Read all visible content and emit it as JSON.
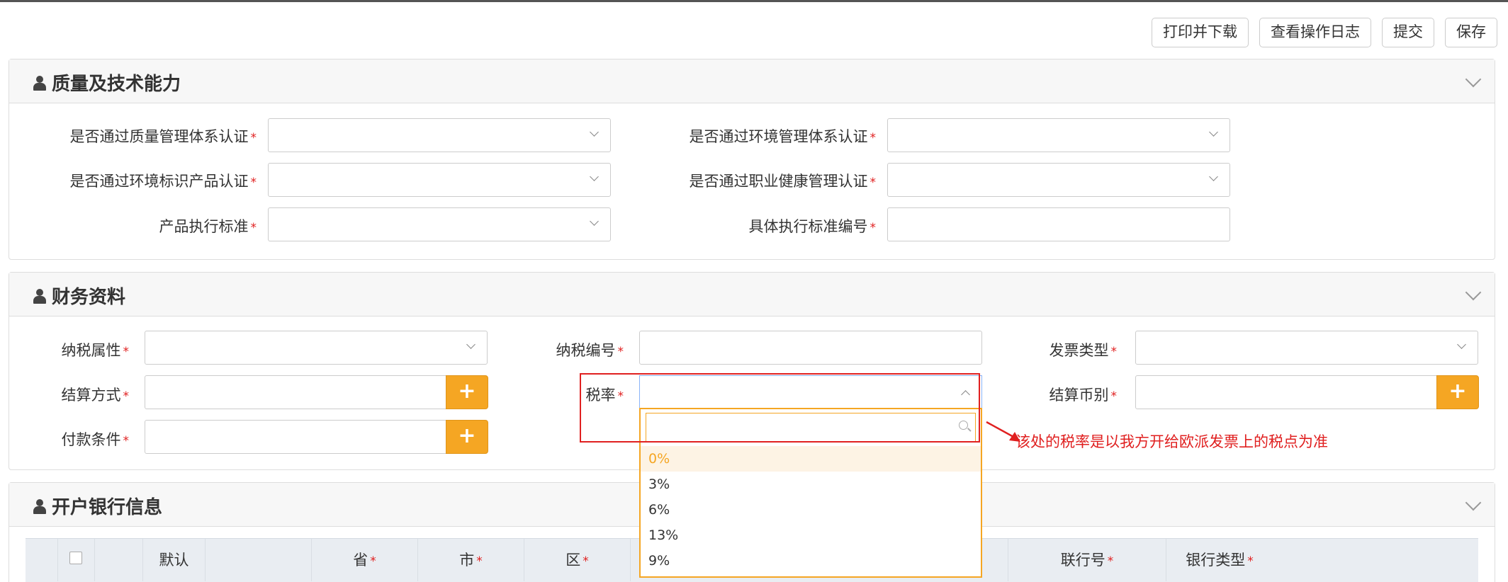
{
  "toolbar": {
    "print_label": "打印并下载",
    "log_label": "查看操作日志",
    "submit_label": "提交",
    "save_label": "保存"
  },
  "quality": {
    "title": "质量及技术能力",
    "fields": {
      "qms": "是否通过质量管理体系认证",
      "ems": "是否通过环境管理体系认证",
      "eco_label": "是否通过环境标识产品认证",
      "ohs": "是否通过职业健康管理认证",
      "standard": "产品执行标准",
      "standard_no": "具体执行标准编号"
    },
    "required_mark": "*"
  },
  "finance": {
    "title": "财务资料",
    "fields": {
      "tax_attr": "纳税属性",
      "tax_no": "纳税编号",
      "invoice_type": "发票类型",
      "settle_method": "结算方式",
      "tax_rate": "税率",
      "currency": "结算币别",
      "payment_terms": "付款条件"
    },
    "add_label": "+",
    "tax_rate_options": [
      "0%",
      "3%",
      "6%",
      "13%",
      "9%"
    ]
  },
  "annotation": "该处的税率是以我方开给欧派发票上的税点为准",
  "bank": {
    "title": "开户银行信息",
    "columns": {
      "default": "默认",
      "province": "省",
      "city": "市",
      "district": "区",
      "bank_code": "联行号",
      "bank_type": "银行类型"
    }
  },
  "icons": [
    "user-icon",
    "chevron-down-icon",
    "chevron-up-icon",
    "search-icon",
    "plus-icon",
    "arrow-icon"
  ],
  "colors": {
    "accent": "#f5a623",
    "required": "#e02020",
    "annotation": "#e02020"
  }
}
